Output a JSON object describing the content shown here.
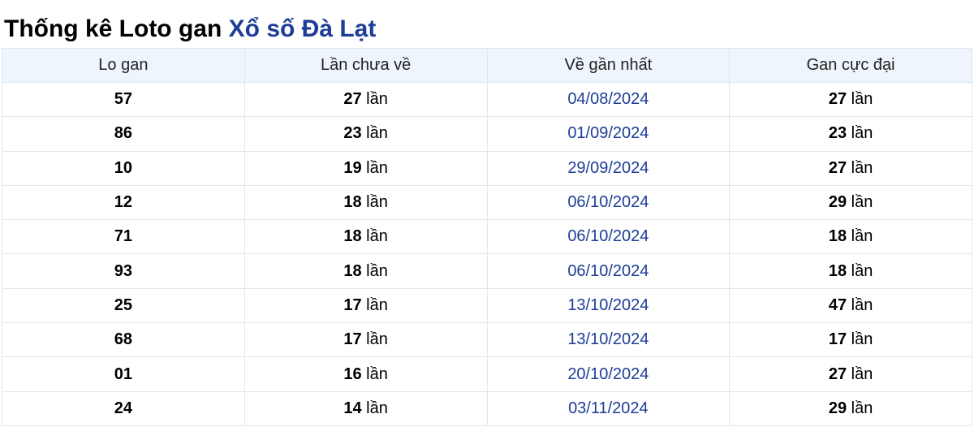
{
  "heading": {
    "prefix": "Thống kê Loto gan",
    "link": "Xổ số Đà Lạt"
  },
  "colors": {
    "link": "#1d3d97",
    "header_bg": "#eef5fc",
    "border": "#dfe6ee"
  },
  "table": {
    "headers": [
      "Lo gan",
      "Lần chưa về",
      "Về gần nhất",
      "Gan cực đại"
    ],
    "unit": "lần",
    "rows": [
      {
        "number": "57",
        "missed": "27",
        "last_date": "04/08/2024",
        "max_gap": "27"
      },
      {
        "number": "86",
        "missed": "23",
        "last_date": "01/09/2024",
        "max_gap": "23"
      },
      {
        "number": "10",
        "missed": "19",
        "last_date": "29/09/2024",
        "max_gap": "27"
      },
      {
        "number": "12",
        "missed": "18",
        "last_date": "06/10/2024",
        "max_gap": "29"
      },
      {
        "number": "71",
        "missed": "18",
        "last_date": "06/10/2024",
        "max_gap": "18"
      },
      {
        "number": "93",
        "missed": "18",
        "last_date": "06/10/2024",
        "max_gap": "18"
      },
      {
        "number": "25",
        "missed": "17",
        "last_date": "13/10/2024",
        "max_gap": "47"
      },
      {
        "number": "68",
        "missed": "17",
        "last_date": "13/10/2024",
        "max_gap": "17"
      },
      {
        "number": "01",
        "missed": "16",
        "last_date": "20/10/2024",
        "max_gap": "27"
      },
      {
        "number": "24",
        "missed": "14",
        "last_date": "03/11/2024",
        "max_gap": "29"
      }
    ]
  }
}
